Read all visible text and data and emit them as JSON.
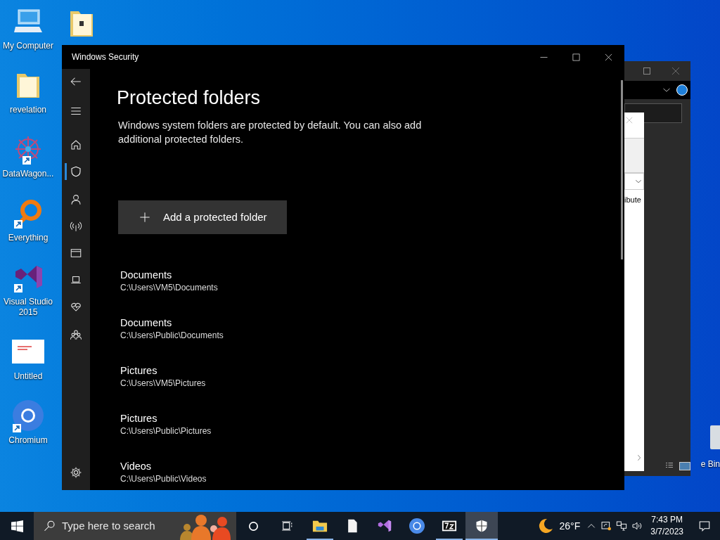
{
  "desktop_icons": [
    {
      "kind": "computer",
      "label": "My Computer"
    },
    {
      "kind": "folder",
      "label": "revelation"
    },
    {
      "kind": "datawagon",
      "label": "DataWagon..."
    },
    {
      "kind": "everything",
      "label": "Everything"
    },
    {
      "kind": "vs",
      "label": "Visual Studio 2015"
    },
    {
      "kind": "document",
      "label": "Untitled"
    },
    {
      "kind": "chromium",
      "label": "Chromium"
    }
  ],
  "back_window": {
    "column_text": "ibute",
    "recycle_label": "e Bin"
  },
  "window": {
    "title": "Windows Security",
    "nav": [
      {
        "kind": "back",
        "selected": false
      },
      {
        "kind": "menu",
        "selected": false
      },
      {
        "kind": "home",
        "selected": false
      },
      {
        "kind": "shield",
        "selected": true
      },
      {
        "kind": "person",
        "selected": false
      },
      {
        "kind": "wireless",
        "selected": false
      },
      {
        "kind": "browser",
        "selected": false
      },
      {
        "kind": "laptop",
        "selected": false
      },
      {
        "kind": "heart",
        "selected": false
      },
      {
        "kind": "family",
        "selected": false
      }
    ],
    "heading": "Protected folders",
    "description": "Windows system folders are protected by default. You can also add additional protected folders.",
    "add_button": "Add a protected folder",
    "folders": [
      {
        "name": "Documents",
        "path": "C:\\Users\\VM5\\Documents"
      },
      {
        "name": "Documents",
        "path": "C:\\Users\\Public\\Documents"
      },
      {
        "name": "Pictures",
        "path": "C:\\Users\\VM5\\Pictures"
      },
      {
        "name": "Pictures",
        "path": "C:\\Users\\Public\\Pictures"
      },
      {
        "name": "Videos",
        "path": "C:\\Users\\Public\\Videos"
      }
    ]
  },
  "taskbar": {
    "search": {
      "placeholder": "Type here to search"
    },
    "apps": [
      {
        "kind": "explorer",
        "running": true,
        "active": false
      },
      {
        "kind": "file",
        "running": false,
        "active": false
      },
      {
        "kind": "vs",
        "running": false,
        "active": false
      },
      {
        "kind": "chromium",
        "running": false,
        "active": false
      },
      {
        "kind": "archive",
        "running": true,
        "active": false
      },
      {
        "kind": "security",
        "running": true,
        "active": true
      }
    ],
    "weather": "26°F",
    "time": "7:43 PM",
    "date": "3/7/2023"
  }
}
